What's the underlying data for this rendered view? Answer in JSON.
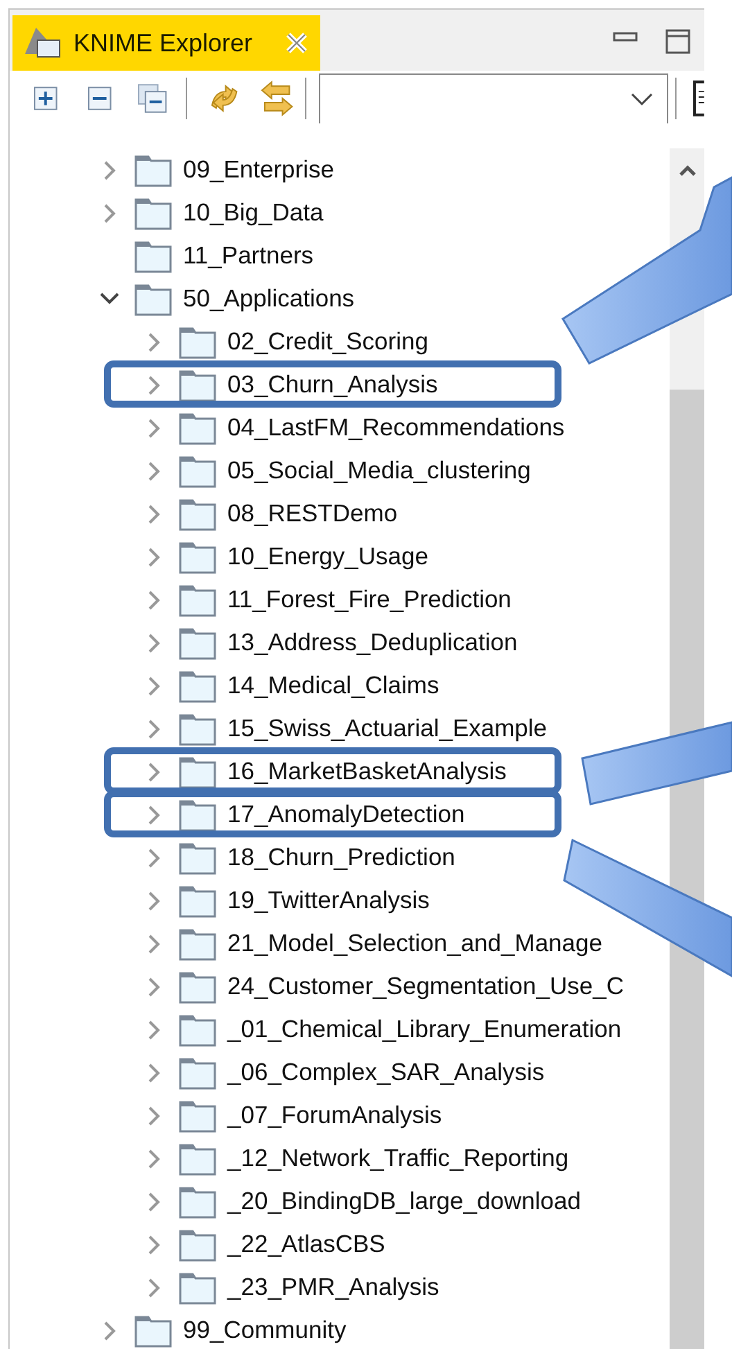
{
  "view_tab": {
    "title": "KNIME Explorer",
    "selected": true
  },
  "tree": [
    {
      "name": "09_Enterprise",
      "expandable": true,
      "expanded": false,
      "highlighted": false
    },
    {
      "name": "10_Big_Data",
      "expandable": true,
      "expanded": false,
      "highlighted": false
    },
    {
      "name": "11_Partners",
      "expandable": false,
      "highlighted": false
    },
    {
      "name": "50_Applications",
      "expandable": true,
      "expanded": true,
      "highlighted": false,
      "children": [
        {
          "name": "02_Credit_Scoring",
          "expandable": true,
          "expanded": false,
          "highlighted": false
        },
        {
          "name": "03_Churn_Analysis",
          "expandable": true,
          "expanded": false,
          "highlighted": true
        },
        {
          "name": "04_LastFM_Recommendations",
          "expandable": true,
          "expanded": false,
          "highlighted": false
        },
        {
          "name": "05_Social_Media_clustering",
          "expandable": true,
          "expanded": false,
          "highlighted": false
        },
        {
          "name": "08_RESTDemo",
          "expandable": true,
          "expanded": false,
          "highlighted": false
        },
        {
          "name": "10_Energy_Usage",
          "expandable": true,
          "expanded": false,
          "highlighted": false
        },
        {
          "name": "11_Forest_Fire_Prediction",
          "expandable": true,
          "expanded": false,
          "highlighted": false
        },
        {
          "name": "13_Address_Deduplication",
          "expandable": true,
          "expanded": false,
          "highlighted": false
        },
        {
          "name": "14_Medical_Claims",
          "expandable": true,
          "expanded": false,
          "highlighted": false
        },
        {
          "name": "15_Swiss_Actuarial_Example",
          "expandable": true,
          "expanded": false,
          "highlighted": false
        },
        {
          "name": "16_MarketBasketAnalysis",
          "expandable": true,
          "expanded": false,
          "highlighted": true
        },
        {
          "name": "17_AnomalyDetection",
          "expandable": true,
          "expanded": false,
          "highlighted": true
        },
        {
          "name": "18_Churn_Prediction",
          "expandable": true,
          "expanded": false,
          "highlighted": false
        },
        {
          "name": "19_TwitterAnalysis",
          "expandable": true,
          "expanded": false,
          "highlighted": false
        },
        {
          "name": "21_Model_Selection_and_Manage",
          "expandable": true,
          "expanded": false,
          "highlighted": false
        },
        {
          "name": "24_Customer_Segmentation_Use_C",
          "expandable": true,
          "expanded": false,
          "highlighted": false
        },
        {
          "name": "_01_Chemical_Library_Enumeration",
          "expandable": true,
          "expanded": false,
          "highlighted": false
        },
        {
          "name": "_06_Complex_SAR_Analysis",
          "expandable": true,
          "expanded": false,
          "highlighted": false
        },
        {
          "name": "_07_ForumAnalysis",
          "expandable": true,
          "expanded": false,
          "highlighted": false
        },
        {
          "name": "_12_Network_Traffic_Reporting",
          "expandable": true,
          "expanded": false,
          "highlighted": false
        },
        {
          "name": "_20_BindingDB_large_download",
          "expandable": true,
          "expanded": false,
          "highlighted": false
        },
        {
          "name": "_22_AtlasCBS",
          "expandable": true,
          "expanded": false,
          "highlighted": false
        },
        {
          "name": "_23_PMR_Analysis",
          "expandable": true,
          "expanded": false,
          "highlighted": false
        }
      ]
    },
    {
      "name": "99_Community",
      "expandable": true,
      "expanded": false,
      "highlighted": false
    }
  ]
}
